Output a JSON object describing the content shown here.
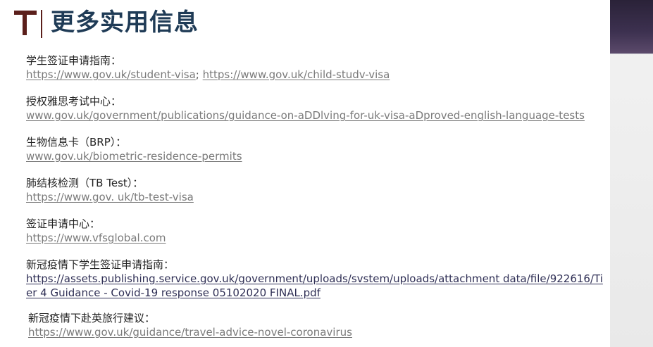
{
  "title": "更多实用信息",
  "colors": {
    "title": "#1f3b56",
    "logo": "#5b1f1b",
    "link": "#7a7a7a",
    "link_dark": "#2f2f55",
    "label": "#222222"
  },
  "items": [
    {
      "label": "学生签证申请指南：",
      "links": [
        "https://www.gov.uk/student-visa",
        "https://www.gov.uk/child-studv-visa"
      ],
      "separator": ";"
    },
    {
      "label": "授权雅思考试中心：",
      "links": [
        "www.gov.uk/government/publications/guidance-on-aDDlving-for-uk-visa-aDproved-english-language-tests"
      ]
    },
    {
      "label": "生物信息卡（BRP）：",
      "links": [
        "www.gov.uk/biometric-residence-permits"
      ]
    },
    {
      "label": "肺结核检测（TB Test）：",
      "links": [
        "https://www.gov. uk/tb-test-visa"
      ]
    },
    {
      "label": "签证申请中心：",
      "links": [
        "https://www.vfsglobal.com"
      ]
    },
    {
      "label": "新冠疫情下学生签证申请指南：",
      "links": [
        "https://assets.publishing.service.gov.uk/government/uploads/svstem/uploads/attachment data/file/922616/Tier 4 Guidance - Covid-19 response 05102020 FINAL.pdf"
      ]
    },
    {
      "label": "新冠疫情下赴英旅行建议：",
      "links": [
        "https://www.gov.uk/guidance/travel-advice-novel-coronavirus"
      ]
    }
  ]
}
